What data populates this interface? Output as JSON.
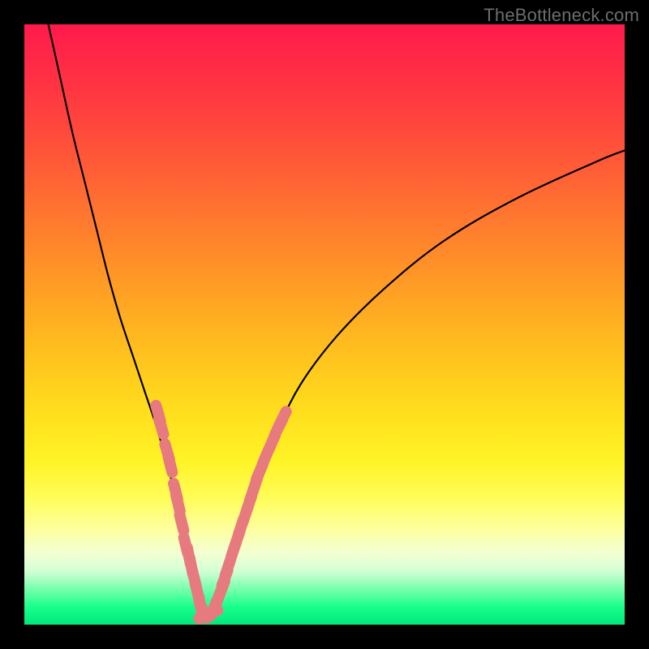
{
  "watermark": "TheBottleneck.com",
  "colors": {
    "background": "#000000",
    "curve": "#000000",
    "marker_fill": "#e77a7e",
    "gradient_top": "#ff1a4b",
    "gradient_bottom": "#00e77b"
  },
  "chart_data": {
    "type": "line",
    "title": "",
    "xlabel": "",
    "ylabel": "",
    "xlim": [
      0,
      100
    ],
    "ylim": [
      0,
      100
    ],
    "grid": false,
    "legend": false,
    "series": [
      {
        "name": "bottleneck-curve",
        "x": [
          4,
          6,
          8,
          10,
          12,
          14,
          16,
          18,
          20,
          22,
          24,
          25.5,
          27,
          28,
          29,
          29.5,
          30,
          31,
          32,
          33.5,
          35,
          37,
          39,
          42,
          46,
          52,
          60,
          70,
          82,
          95,
          100
        ],
        "y": [
          100,
          91,
          82,
          74,
          66,
          58,
          51,
          45,
          39,
          33,
          26,
          20,
          14,
          9,
          5,
          2.5,
          1.5,
          2,
          4.5,
          8.5,
          13,
          19,
          25,
          32,
          40,
          48,
          56,
          64,
          71,
          77,
          79
        ]
      }
    ],
    "markers": [
      {
        "name": "markers-left",
        "points": [
          {
            "x": 22.3,
            "y": 35.2
          },
          {
            "x": 22.8,
            "y": 33.0
          },
          {
            "x": 23.8,
            "y": 28.8
          },
          {
            "x": 24.3,
            "y": 26.7
          },
          {
            "x": 25.2,
            "y": 22.2
          },
          {
            "x": 25.6,
            "y": 20.2
          },
          {
            "x": 26.2,
            "y": 17.0
          },
          {
            "x": 26.9,
            "y": 13.2
          },
          {
            "x": 27.4,
            "y": 11.5
          },
          {
            "x": 27.8,
            "y": 9.8
          },
          {
            "x": 28.3,
            "y": 7.7
          }
        ]
      },
      {
        "name": "markers-bottom",
        "points": [
          {
            "x": 28.8,
            "y": 5.5
          },
          {
            "x": 29.3,
            "y": 3.4
          },
          {
            "x": 29.8,
            "y": 2.3
          },
          {
            "x": 30.3,
            "y": 1.6
          },
          {
            "x": 31.0,
            "y": 1.8
          },
          {
            "x": 31.6,
            "y": 2.8
          },
          {
            "x": 32.2,
            "y": 4.2
          }
        ]
      },
      {
        "name": "markers-right",
        "points": [
          {
            "x": 32.9,
            "y": 6.0
          },
          {
            "x": 33.4,
            "y": 7.8
          },
          {
            "x": 33.9,
            "y": 9.5
          },
          {
            "x": 34.9,
            "y": 12.6
          },
          {
            "x": 35.5,
            "y": 14.4
          },
          {
            "x": 36.1,
            "y": 16.3
          },
          {
            "x": 36.8,
            "y": 18.3
          },
          {
            "x": 37.4,
            "y": 20.1
          },
          {
            "x": 38.0,
            "y": 22.0
          },
          {
            "x": 38.6,
            "y": 23.8
          },
          {
            "x": 39.2,
            "y": 25.5
          },
          {
            "x": 40.2,
            "y": 28.0
          },
          {
            "x": 41.3,
            "y": 30.5
          },
          {
            "x": 42.4,
            "y": 33.0
          },
          {
            "x": 43.0,
            "y": 34.3
          }
        ]
      }
    ]
  }
}
